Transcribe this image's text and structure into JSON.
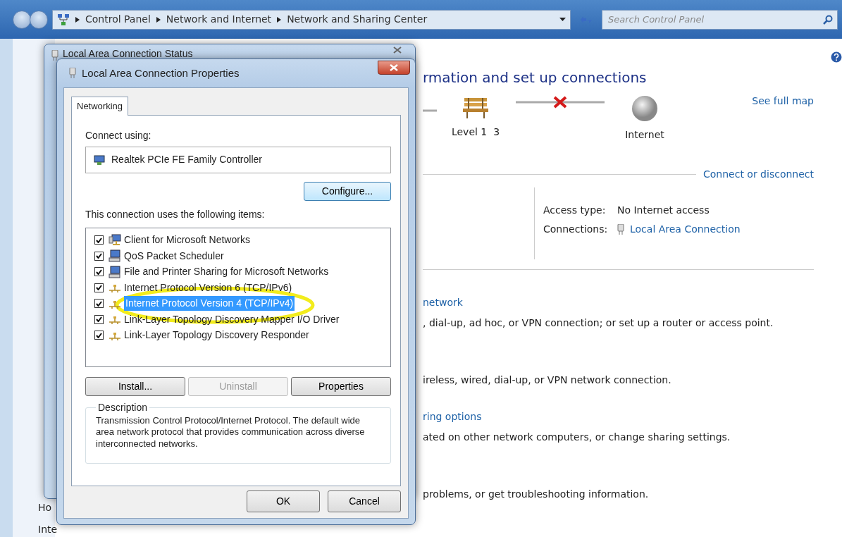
{
  "address_bar": {
    "crumbs": [
      "Control Panel",
      "Network and Internet",
      "Network and Sharing Center"
    ]
  },
  "search": {
    "placeholder": "Search Control Panel"
  },
  "left_pane": {
    "items": [
      "Ho",
      "Inte"
    ]
  },
  "heading": "rmation and set up connections",
  "network_map": {
    "nodes": [
      {
        "kind": "bench",
        "label": "Level 1  3"
      },
      {
        "kind": "globe",
        "label": "Internet"
      }
    ],
    "link_broken": true,
    "see_full_map": "See full map"
  },
  "connect_link": "Connect or disconnect",
  "details": [
    {
      "label": "Access type:",
      "value": "No Internet access",
      "kind": "text"
    },
    {
      "label": "Connections:",
      "value": "Local Area Connection",
      "kind": "link"
    }
  ],
  "tasks": [
    {
      "title": "network",
      "description": ", dial-up, ad hoc, or VPN connection; or set up a router or access point."
    },
    {
      "description": "ireless, wired, dial-up, or VPN network connection."
    },
    {
      "title": "ring options",
      "description": "ated on other network computers, or change sharing settings."
    },
    {
      "description": "problems, or get troubleshooting information."
    }
  ],
  "status_window": {
    "title": "Local Area Connection Status"
  },
  "dialog": {
    "title": "Local Area Connection Properties",
    "tabs": [
      {
        "label": "Networking",
        "selected": true
      }
    ],
    "connect_using_label": "Connect using:",
    "adapter": "Realtek PCIe FE Family Controller",
    "configure_button": "Configure...",
    "items_label": "This connection uses the following items:",
    "items": [
      {
        "label": "Client for Microsoft Networks",
        "kind": "client",
        "checked": true,
        "selected": false
      },
      {
        "label": "QoS Packet Scheduler",
        "kind": "service",
        "checked": true,
        "selected": false
      },
      {
        "label": "File and Printer Sharing for Microsoft Networks",
        "kind": "service",
        "checked": true,
        "selected": false
      },
      {
        "label": "Internet Protocol Version 6 (TCP/IPv6)",
        "kind": "protocol",
        "checked": true,
        "selected": false
      },
      {
        "label": "Internet Protocol Version 4 (TCP/IPv4)",
        "kind": "protocol",
        "checked": true,
        "selected": true
      },
      {
        "label": "Link-Layer Topology Discovery Mapper I/O Driver",
        "kind": "protocol",
        "checked": true,
        "selected": false
      },
      {
        "label": "Link-Layer Topology Discovery Responder",
        "kind": "protocol",
        "checked": true,
        "selected": false
      }
    ],
    "buttons": [
      {
        "label": "Install...",
        "disabled": false
      },
      {
        "label": "Uninstall",
        "disabled": true
      },
      {
        "label": "Properties",
        "disabled": false
      }
    ],
    "description": {
      "legend": "Description",
      "text": "Transmission Control Protocol/Internet Protocol. The default wide area network protocol that provides communication across diverse interconnected networks."
    },
    "footer_buttons": [
      "OK",
      "Cancel"
    ]
  }
}
